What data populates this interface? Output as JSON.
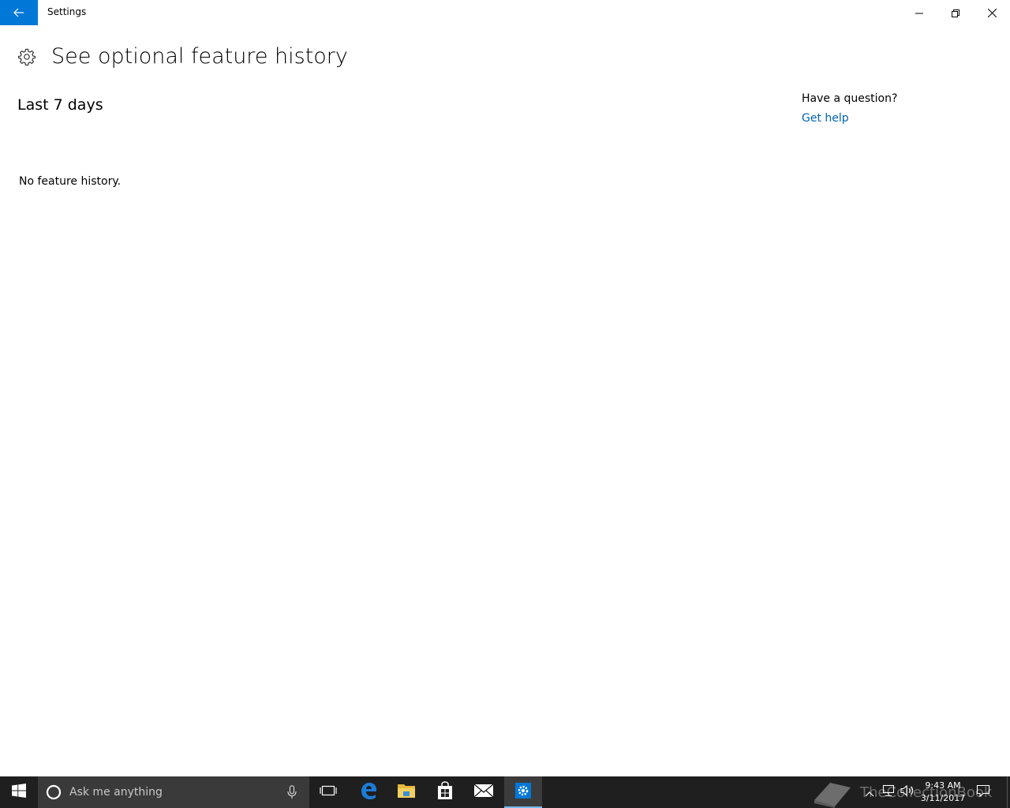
{
  "window": {
    "app_title": "Settings",
    "accent_color": "#0078d7"
  },
  "titlebar": {
    "back_icon": "back-arrow-icon",
    "minimize_icon": "minimize-icon",
    "restore_icon": "restore-icon",
    "close_icon": "close-icon"
  },
  "header": {
    "icon": "gear-icon",
    "title": "See optional feature history"
  },
  "content": {
    "section_title": "Last 7 days",
    "empty_message": "No feature history."
  },
  "help": {
    "question": "Have a question?",
    "link_label": "Get help",
    "link_color": "#0063b1"
  },
  "taskbar": {
    "search_placeholder": "Ask me anything",
    "pinned_apps": [
      "windows-start-icon",
      "task-view-icon",
      "edge-icon",
      "file-explorer-icon",
      "store-icon",
      "mail-icon",
      "settings-icon"
    ],
    "active_app": "Settings",
    "clock": {
      "time": "9:43 AM",
      "date": "3/11/2017"
    },
    "watermark": "TheCollectionBook"
  }
}
